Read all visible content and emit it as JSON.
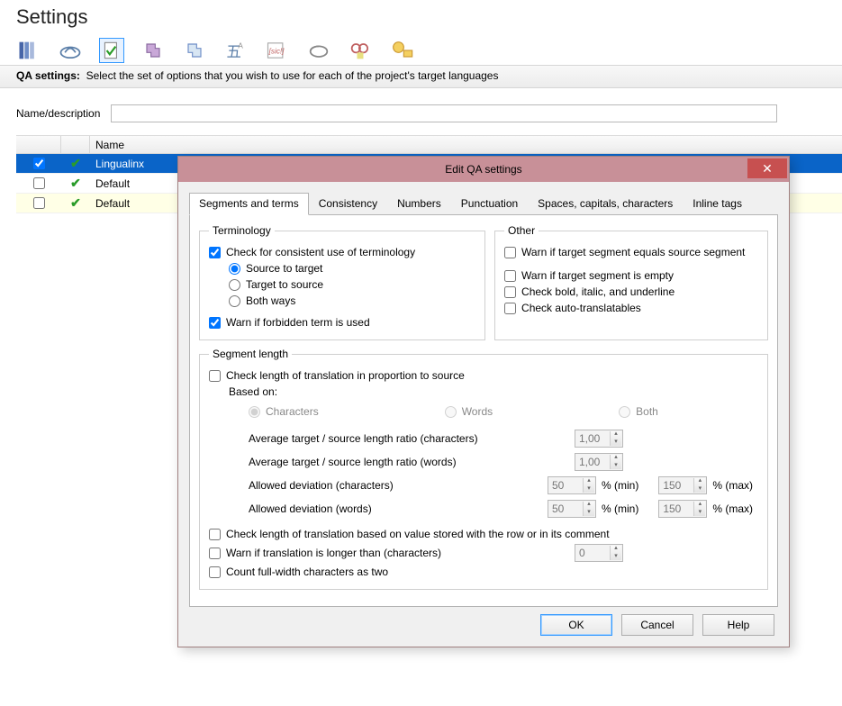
{
  "page": {
    "title": "Settings",
    "qa_label": "QA settings:",
    "qa_desc": "Select the set of options that you wish to use for each of the project's target languages",
    "name_label": "Name/description",
    "name_value": ""
  },
  "grid": {
    "col_name": "Name",
    "rows": [
      {
        "checked": true,
        "name": "Lingualinx",
        "selected": true,
        "alt": false
      },
      {
        "checked": false,
        "name": "Default",
        "selected": false,
        "alt": false
      },
      {
        "checked": false,
        "name": "Default",
        "selected": false,
        "alt": true
      }
    ]
  },
  "dialog": {
    "title": "Edit QA settings",
    "tabs": [
      "Segments and terms",
      "Consistency",
      "Numbers",
      "Punctuation",
      "Spaces, capitals, characters",
      "Inline tags"
    ],
    "active_tab": 0,
    "terminology": {
      "legend": "Terminology",
      "check_consistent": "Check for consistent use of terminology",
      "check_consistent_val": true,
      "dir_s2t": "Source to target",
      "dir_t2s": "Target to source",
      "dir_both": "Both ways",
      "dir_selected": "s2t",
      "warn_forbidden": "Warn if forbidden term is used",
      "warn_forbidden_val": true
    },
    "other": {
      "legend": "Other",
      "warn_equals": "Warn if target segment equals source segment",
      "warn_equals_val": false,
      "warn_empty": "Warn if target segment is empty",
      "warn_empty_val": false,
      "check_biu": "Check bold, italic, and underline",
      "check_biu_val": false,
      "check_auto": "Check auto-translatables",
      "check_auto_val": false
    },
    "seglen": {
      "legend": "Segment length",
      "check_prop": "Check length of translation in proportion to source",
      "check_prop_val": false,
      "based_on": "Based on:",
      "basis_chars": "Characters",
      "basis_words": "Words",
      "basis_both": "Both",
      "basis_selected": "chars",
      "avg_chars": "Average target / source length ratio (characters)",
      "avg_chars_val": "1,00",
      "avg_words": "Average target / source length ratio (words)",
      "avg_words_val": "1,00",
      "dev_chars": "Allowed deviation (characters)",
      "dev_chars_min": "50",
      "dev_chars_max": "150",
      "dev_words": "Allowed deviation (words)",
      "dev_words_min": "50",
      "dev_words_max": "150",
      "pct_min": "% (min)",
      "pct_max": "% (max)",
      "check_stored": "Check length of translation based on value stored with the row or in its comment",
      "check_stored_val": false,
      "warn_longer": "Warn if translation is longer than (characters)",
      "warn_longer_val": false,
      "warn_longer_num": "0",
      "count_fw": "Count full-width characters as two",
      "count_fw_val": false
    },
    "buttons": {
      "ok": "OK",
      "cancel": "Cancel",
      "help": "Help"
    }
  }
}
